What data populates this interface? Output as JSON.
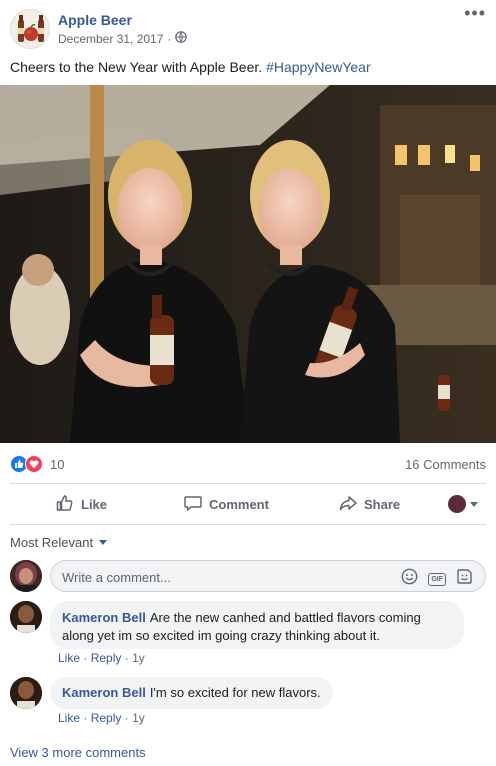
{
  "post": {
    "page_name": "Apple Beer",
    "date": "December 31, 2017",
    "date_separator": "·",
    "audience_icon": "globe-icon",
    "more_icon": "more-dots-icon",
    "text_main": "Cheers to the New Year with Apple Beer.",
    "hashtag": "#HappyNewYear"
  },
  "reactions": {
    "icons": [
      "like-reaction-icon",
      "love-reaction-icon"
    ],
    "count": "10",
    "comments_count": "16 Comments"
  },
  "actions": {
    "like_label": "Like",
    "comment_label": "Comment",
    "share_label": "Share"
  },
  "comments_section": {
    "sort_label": "Most Relevant",
    "composer_placeholder": "Write a comment...",
    "composer_icons": [
      "emoji-icon",
      "gif-icon",
      "sticker-icon"
    ],
    "gif_text": "GIF",
    "comments": [
      {
        "author": "Kameron Bell",
        "text_line1": "Are the new canhed and battled flavors coming",
        "text_line2": "along yet im so excited im going crazy thinking about it.",
        "like": "Like",
        "reply": "Reply",
        "time": "1y"
      },
      {
        "author": "Kameron Bell",
        "text_line1": "I'm so excited for new flavors.",
        "like": "Like",
        "reply": "Reply",
        "time": "1y"
      }
    ],
    "view_more": "View 3 more comments"
  },
  "colors": {
    "link_blue": "#385898",
    "like_blue": "#1877f2",
    "love_red": "#f33e58",
    "secondary_text": "#606770"
  }
}
